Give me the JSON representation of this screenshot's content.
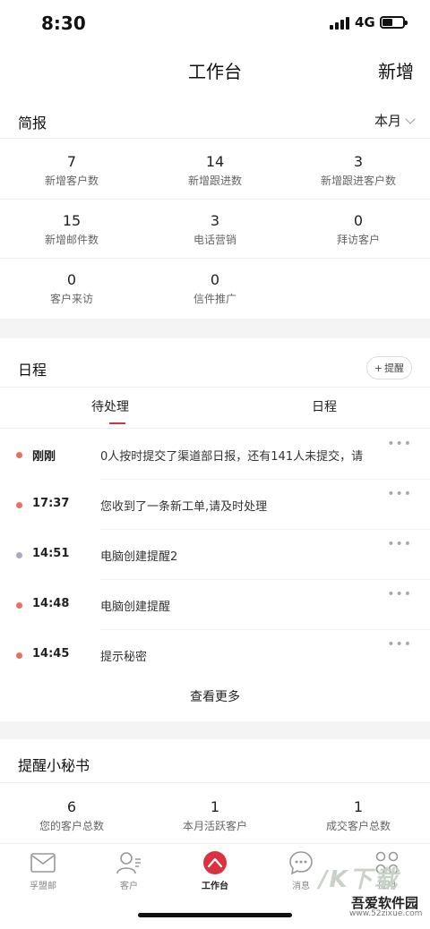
{
  "status_bar": {
    "time": "8:30",
    "network": "4G"
  },
  "header": {
    "title": "工作台",
    "action": "新增"
  },
  "brief": {
    "title": "简报",
    "period": "本月",
    "stats": [
      {
        "value": "7",
        "label": "新增客户数"
      },
      {
        "value": "14",
        "label": "新增跟进数"
      },
      {
        "value": "3",
        "label": "新增跟进客户数"
      },
      {
        "value": "15",
        "label": "新增邮件数"
      },
      {
        "value": "3",
        "label": "电话营销"
      },
      {
        "value": "0",
        "label": "拜访客户"
      },
      {
        "value": "0",
        "label": "客户来访"
      },
      {
        "value": "0",
        "label": "信件推广"
      }
    ]
  },
  "schedule": {
    "title": "日程",
    "remind_button": "提醒",
    "tabs": [
      "待处理",
      "日程"
    ],
    "items": [
      {
        "time": "刚刚",
        "text": "0人按时提交了渠道部日报，还有141人未提交，请",
        "dot_color": "#e8705e"
      },
      {
        "time": "17:37",
        "text": "您收到了一条新工单,请及时处理",
        "dot_color": "#e8705e"
      },
      {
        "time": "14:51",
        "text": "电脑创建提醒2",
        "dot_color": "#a8adbd"
      },
      {
        "time": "14:48",
        "text": "电脑创建提醒",
        "dot_color": "#e8705e"
      },
      {
        "time": "14:45",
        "text": "提示秘密",
        "dot_color": "#e8705e"
      }
    ],
    "see_more": "查看更多"
  },
  "secretary": {
    "title": "提醒小秘书",
    "stats": [
      {
        "value": "6",
        "label": "您的客户总数"
      },
      {
        "value": "1",
        "label": "本月活跃客户"
      },
      {
        "value": "1",
        "label": "成交客户总数"
      }
    ]
  },
  "tabbar": {
    "items": [
      {
        "label": "孚盟邮",
        "icon": "mail-icon"
      },
      {
        "label": "客户",
        "icon": "contacts-icon"
      },
      {
        "label": "工作台",
        "icon": "workbench-icon"
      },
      {
        "label": "消息",
        "icon": "message-icon"
      },
      {
        "label": "应用",
        "icon": "apps-icon"
      }
    ]
  },
  "watermark": {
    "name": "吾爱软件园",
    "url": "www.52zixue.com"
  },
  "colors": {
    "accent": "#d9333f",
    "dot_red": "#e8705e",
    "dot_gray": "#a8adbd"
  }
}
